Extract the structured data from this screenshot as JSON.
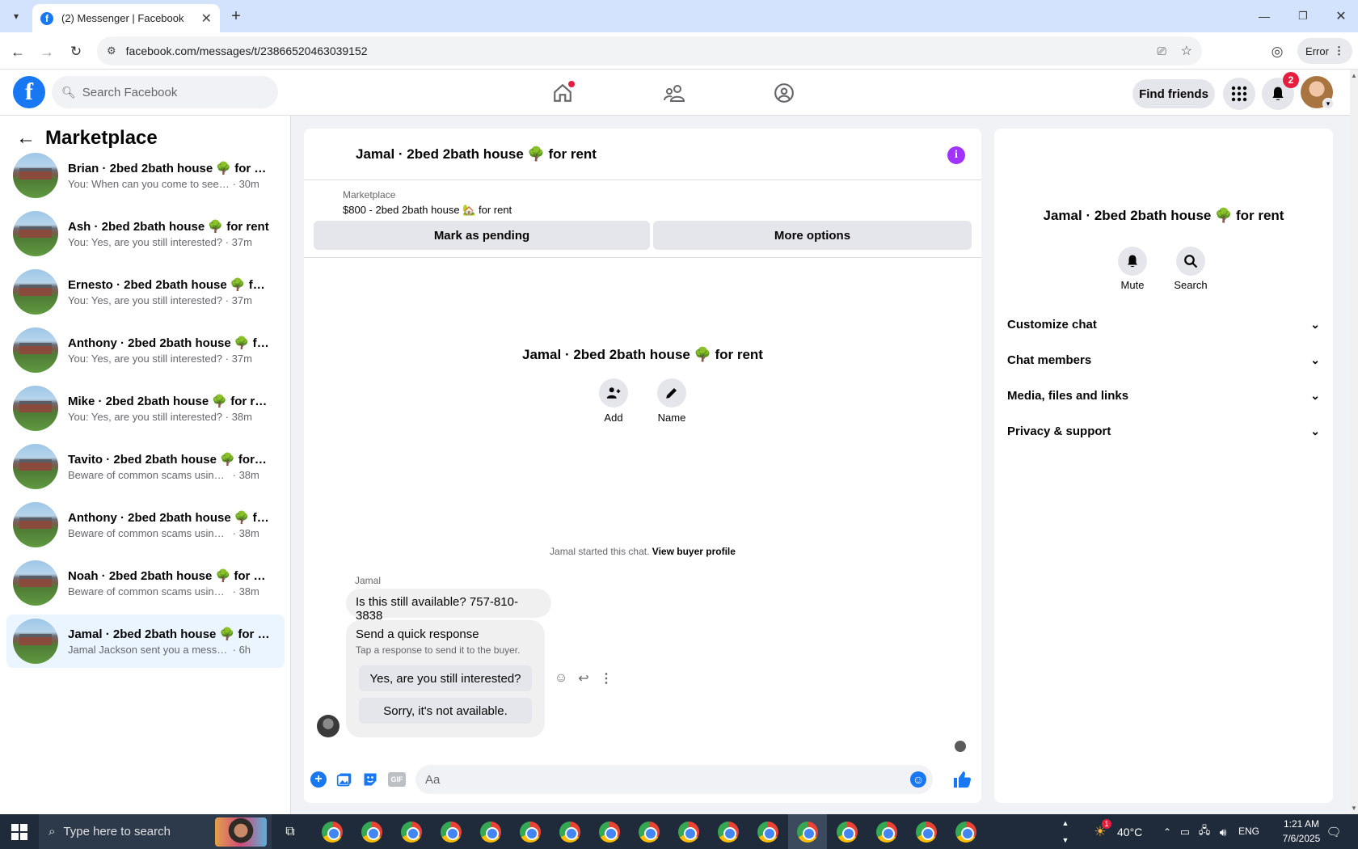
{
  "browser": {
    "tab_title": "(2) Messenger | Facebook",
    "url": "facebook.com/messages/t/23866520463039152",
    "profile_status": "Error"
  },
  "fb": {
    "search_placeholder": "Search Facebook",
    "find_friends": "Find friends",
    "notification_count": "2"
  },
  "left": {
    "title": "Marketplace",
    "conversations": [
      {
        "name": "Brian · 2bed 2bath house 🌳 for rent",
        "preview": "You: When can you come to see the...",
        "time": "· 30m"
      },
      {
        "name": "Ash · 2bed 2bath house 🌳 for rent",
        "preview": "You: Yes, are you still interested?",
        "time": "· 37m"
      },
      {
        "name": "Ernesto · 2bed 2bath house 🌳 for ...",
        "preview": "You: Yes, are you still interested?",
        "time": "· 37m"
      },
      {
        "name": "Anthony · 2bed 2bath house 🌳 fo...",
        "preview": "You: Yes, are you still interested?",
        "time": "· 37m"
      },
      {
        "name": "Mike · 2bed 2bath house 🌳 for rent",
        "preview": "You: Yes, are you still interested?",
        "time": "· 38m"
      },
      {
        "name": "Tavito · 2bed 2bath house 🌳 for r...",
        "preview": "Beware of common scams using pa...",
        "time": "· 38m"
      },
      {
        "name": "Anthony · 2bed 2bath house 🌳 fo...",
        "preview": "Beware of common scams using pa...",
        "time": "· 38m"
      },
      {
        "name": "Noah · 2bed 2bath house 🌳 for re...",
        "preview": "Beware of common scams using pa...",
        "time": "· 38m"
      },
      {
        "name": "Jamal · 2bed 2bath house 🌳 for r...",
        "preview": "Jamal Jackson sent you a message ab...",
        "time": "· 6h"
      }
    ]
  },
  "chat": {
    "title": "Jamal · 2bed 2bath house 🌳 for rent",
    "listing_source": "Marketplace",
    "listing": "$800 - 2bed 2bath house 🏡 for rent",
    "mark_pending": "Mark as pending",
    "more_options": "More options",
    "intro_name": "Jamal · 2bed 2bath house 🌳 for rent",
    "add_label": "Add",
    "name_label": "Name",
    "started_text": "Jamal started this chat.",
    "view_buyer": "View buyer profile",
    "sender": "Jamal",
    "message": "Is this still available? 757-810-3838",
    "quick_title": "Send a quick response",
    "quick_sub": "Tap a response to send it to the buyer.",
    "quick_1": "Yes, are you still interested?",
    "quick_2": "Sorry, it's not available.",
    "composer_placeholder": "Aa"
  },
  "right": {
    "name": "Jamal · 2bed 2bath house 🌳 for rent",
    "mute": "Mute",
    "search": "Search",
    "sections": [
      "Customize chat",
      "Chat members",
      "Media, files and links",
      "Privacy & support"
    ]
  },
  "taskbar": {
    "search_placeholder": "Type here to search",
    "weather": "40°C",
    "lang": "ENG",
    "time": "1:21 AM",
    "date": "7/6/2025",
    "weather_badge": "1"
  },
  "colors": {
    "fb_blue": "#1877f2",
    "messenger_purple": "#a033ff",
    "taskbar": "#1f2b3a"
  }
}
